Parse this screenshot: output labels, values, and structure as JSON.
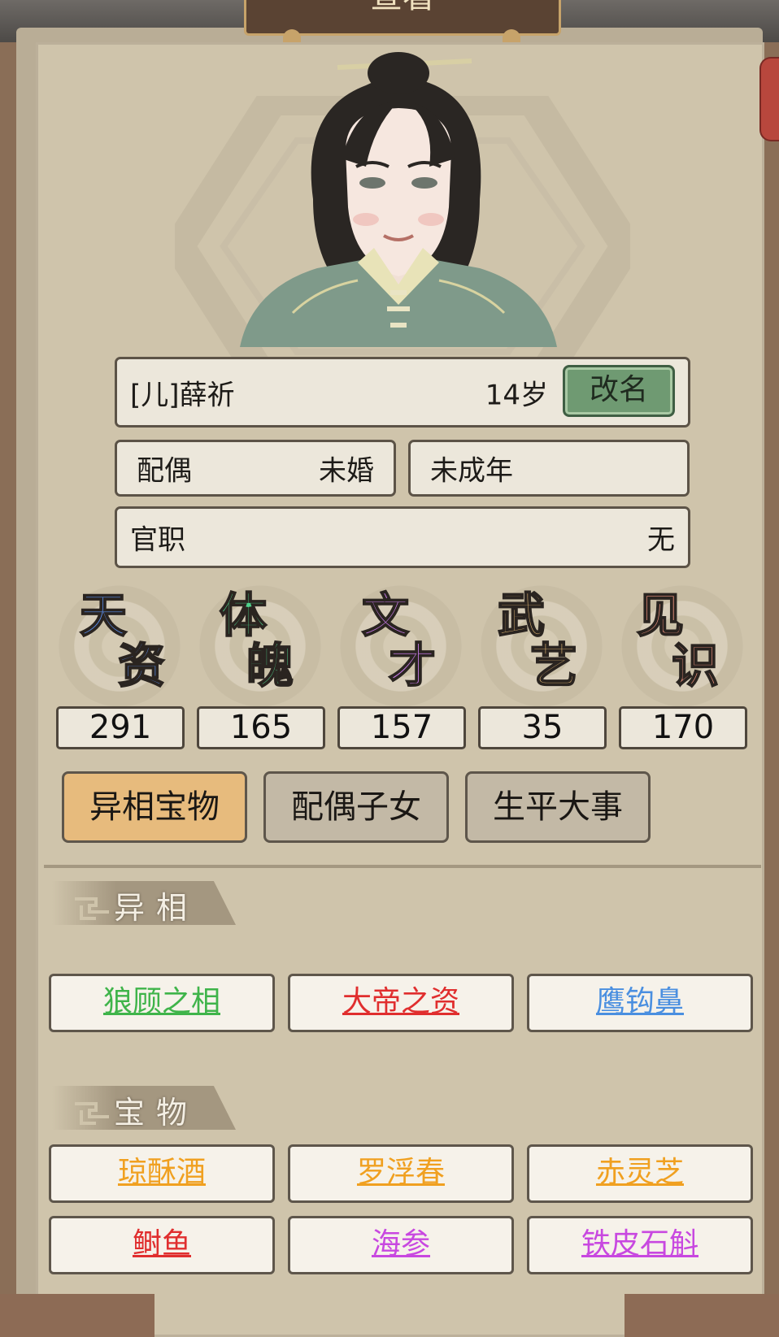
{
  "header": {
    "title": "查看"
  },
  "profile": {
    "name": "[儿]薛祈",
    "age": "14岁",
    "rename_label": "改名",
    "spouse_label": "配偶",
    "spouse_value": "未婚",
    "adult_status": "未成年",
    "office_label": "官职",
    "office_value": "无"
  },
  "stats": [
    {
      "char1": "天",
      "char2": "资",
      "value": "291",
      "color": "#5b8ff0"
    },
    {
      "char1": "体",
      "char2": "魄",
      "value": "165",
      "color": "#4fd28c"
    },
    {
      "char1": "文",
      "char2": "才",
      "value": "157",
      "color": "#c77be8"
    },
    {
      "char1": "武",
      "char2": "艺",
      "value": "35",
      "color": "#f0c27a"
    },
    {
      "char1": "见",
      "char2": "识",
      "value": "170",
      "color": "#f29580"
    }
  ],
  "tabs": [
    {
      "label": "异相宝物",
      "active": true
    },
    {
      "label": "配偶子女",
      "active": false
    },
    {
      "label": "生平大事",
      "active": false
    }
  ],
  "sections": {
    "traits": {
      "title": "异相",
      "items": [
        {
          "label": "狼顾之相",
          "color": "#3fb44a"
        },
        {
          "label": "大帝之资",
          "color": "#e02e2e"
        },
        {
          "label": "鹰钩鼻",
          "color": "#4a8fe0"
        }
      ]
    },
    "treasures": {
      "title": "宝物",
      "items": [
        {
          "label": "琼酥酒",
          "color": "#f0a020"
        },
        {
          "label": "罗浮春",
          "color": "#f0a020"
        },
        {
          "label": "赤灵芝",
          "color": "#f0a020"
        },
        {
          "label": "鲥鱼",
          "color": "#e02e2e"
        },
        {
          "label": "海参",
          "color": "#c848e0"
        },
        {
          "label": "铁皮石斛",
          "color": "#c848e0"
        }
      ]
    }
  }
}
